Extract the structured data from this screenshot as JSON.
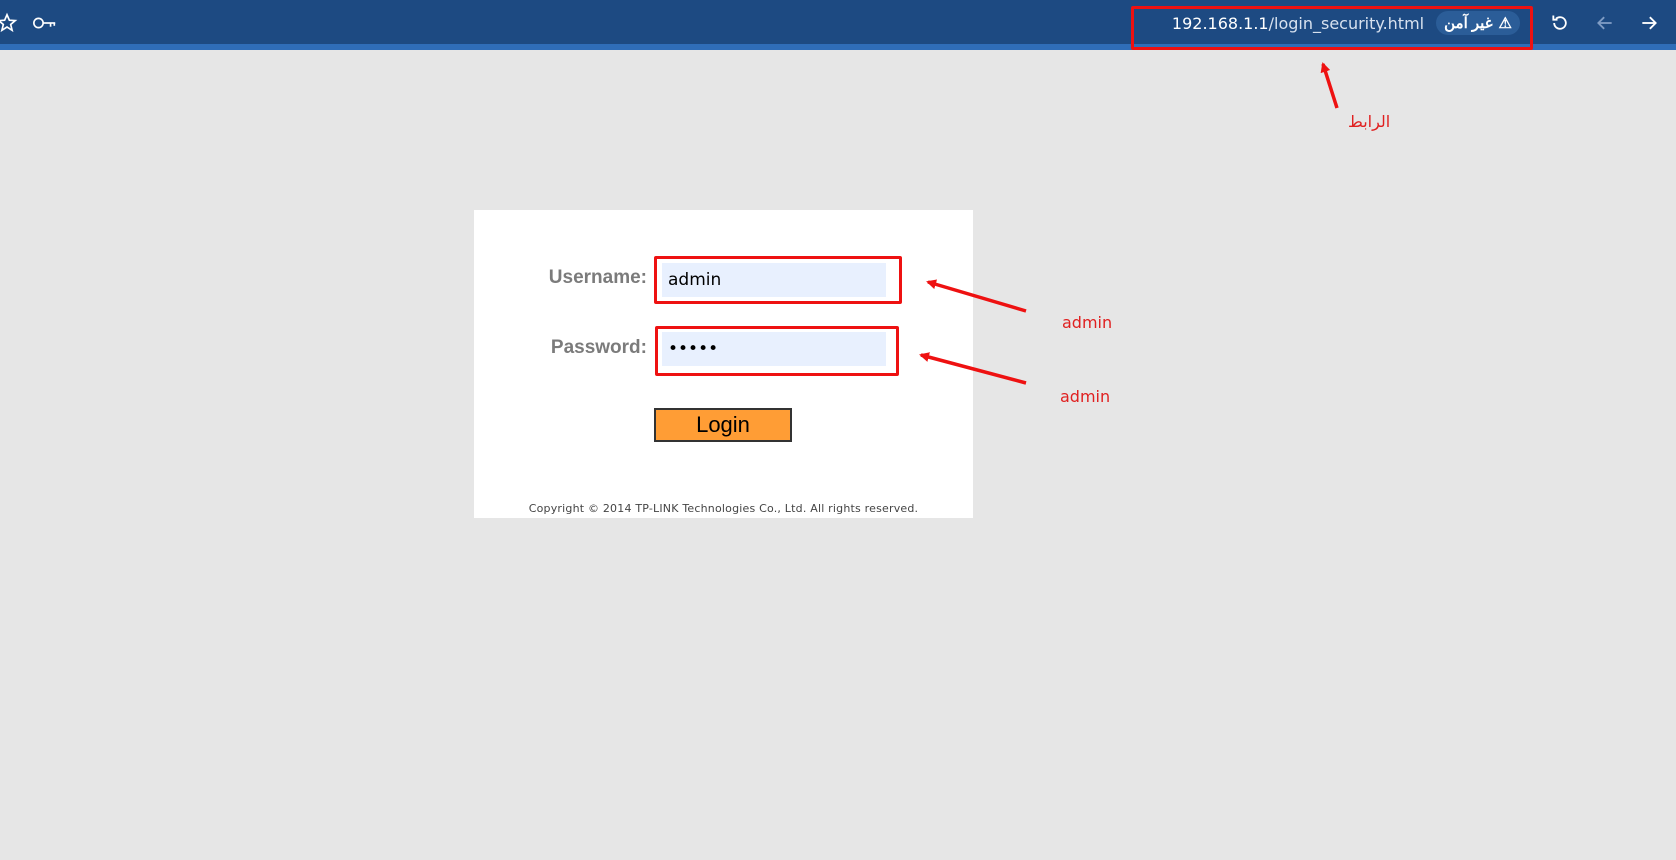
{
  "browser": {
    "url_host": "192.168.1.1",
    "url_path": "/login_security.html",
    "security_label": "غير آمن",
    "icons": [
      "star-icon",
      "key-icon",
      "reload-icon",
      "back-icon",
      "forward-icon",
      "warning-icon"
    ]
  },
  "login": {
    "username_label": "Username:",
    "username_value": "admin",
    "password_label": "Password:",
    "password_value": "admin",
    "login_button": "Login",
    "copyright": "Copyright © 2014 TP-LINK Technologies Co., Ltd. All rights reserved.",
    "button_color": "#ff9d35"
  },
  "annotations": {
    "link_label": "الرابط",
    "username_note": "admin",
    "password_note": "admin",
    "color": "#ee1111"
  }
}
